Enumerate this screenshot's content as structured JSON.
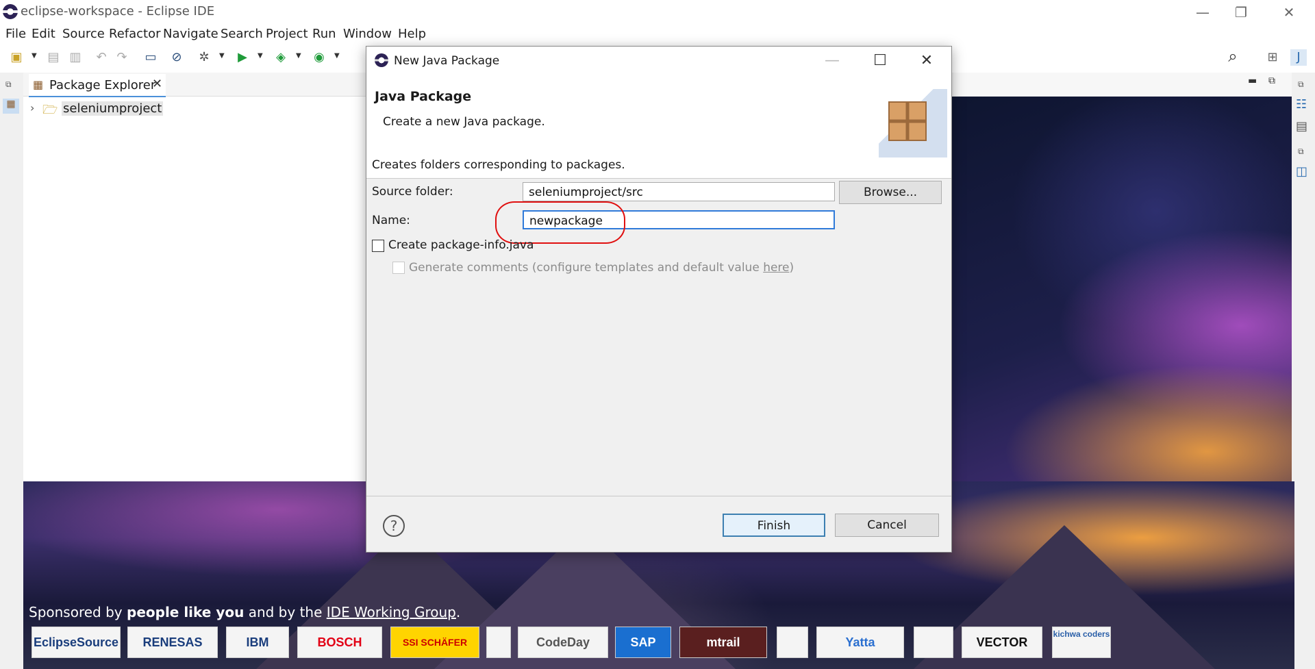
{
  "window": {
    "title": "eclipse-workspace - Eclipse IDE",
    "minimize": "—",
    "restore": "❐",
    "close": "✕"
  },
  "menubar": [
    "File",
    "Edit",
    "Source",
    "Refactor",
    "Navigate",
    "Search",
    "Project",
    "Run",
    "Window",
    "Help"
  ],
  "toolbar": {
    "left_icons": [
      "new-wizard-icon",
      "save-icon",
      "save-all-icon",
      "undo-icon",
      "redo-icon",
      "terminal-icon",
      "skip-breakpoints-icon",
      "debug-icon",
      "run-icon",
      "coverage-icon",
      "external-tools-icon"
    ],
    "right_icons": [
      "search-icon",
      "open-perspective-icon",
      "java-perspective-icon"
    ]
  },
  "package_explorer": {
    "tab_label": "Package Explorer",
    "tree": [
      {
        "label": "seleniumproject",
        "expanded": false
      }
    ]
  },
  "sponsor": {
    "prefix": "Sponsored by ",
    "bold": "people like you",
    "middle": " and by the ",
    "link": "IDE Working Group",
    "suffix": "."
  },
  "sponsor_logos": [
    "EclipseSource",
    "RENESAS",
    "IBM",
    "BOSCH",
    "SSI SCHÄFER",
    "",
    "CodeDay",
    "SAP",
    "mtrail",
    "",
    "Yatta",
    "",
    "VECTOR",
    "kichwa coders"
  ],
  "dialog": {
    "title": "New Java Package",
    "banner_title": "Java Package",
    "banner_description": "Create a new Java package.",
    "message": "Creates folders corresponding to packages.",
    "source_folder_label": "Source folder:",
    "source_folder_value": "seleniumproject/src",
    "browse_label": "Browse...",
    "name_label": "Name:",
    "name_value": "newpackage",
    "create_pkginfo_label": "Create package-info.java",
    "create_pkginfo_checked": false,
    "generate_comments_prefix": "Generate comments (configure templates and default value ",
    "generate_comments_link": "here",
    "generate_comments_suffix": ")",
    "generate_comments_enabled": false,
    "finish_label": "Finish",
    "cancel_label": "Cancel",
    "help_symbol": "?"
  },
  "colors": {
    "highlight_ring": "#e01010",
    "default_button_border": "#3c7fb1"
  }
}
